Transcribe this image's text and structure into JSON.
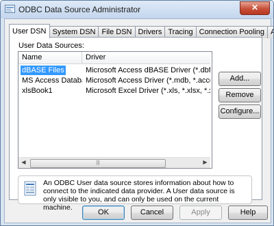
{
  "window": {
    "title": "ODBC Data Source Administrator",
    "close_glyph": "✕"
  },
  "tabs": [
    {
      "label": "User DSN",
      "active": true
    },
    {
      "label": "System DSN",
      "active": false
    },
    {
      "label": "File DSN",
      "active": false
    },
    {
      "label": "Drivers",
      "active": false
    },
    {
      "label": "Tracing",
      "active": false
    },
    {
      "label": "Connection Pooling",
      "active": false
    },
    {
      "label": "About",
      "active": false
    }
  ],
  "section_label": "User Data Sources:",
  "list": {
    "columns": [
      "Name",
      "Driver"
    ],
    "rows": [
      {
        "name": "dBASE Files",
        "driver": "Microsoft Access dBASE Driver (*.dbf, *.ndx",
        "selected": true
      },
      {
        "name": "MS Access Database",
        "driver": "Microsoft Access Driver (*.mdb, *.accdb)",
        "selected": false
      },
      {
        "name": "xlsBook1",
        "driver": "Microsoft Excel Driver (*.xls, *.xlsx, *.xlsm, *.x",
        "selected": false
      }
    ]
  },
  "side_buttons": {
    "add": "Add...",
    "remove": "Remove",
    "configure": "Configure..."
  },
  "info_text": "An ODBC User data source stores information about how to connect to the indicated data provider.   A User data source is only visible to you, and can only be used on the current machine.",
  "bottom_buttons": {
    "ok": "OK",
    "cancel": "Cancel",
    "apply": "Apply",
    "help": "Help"
  },
  "colors": {
    "selection": "#3399ff",
    "title_bar": "#c3d6ee",
    "close_button": "#c7503a"
  }
}
